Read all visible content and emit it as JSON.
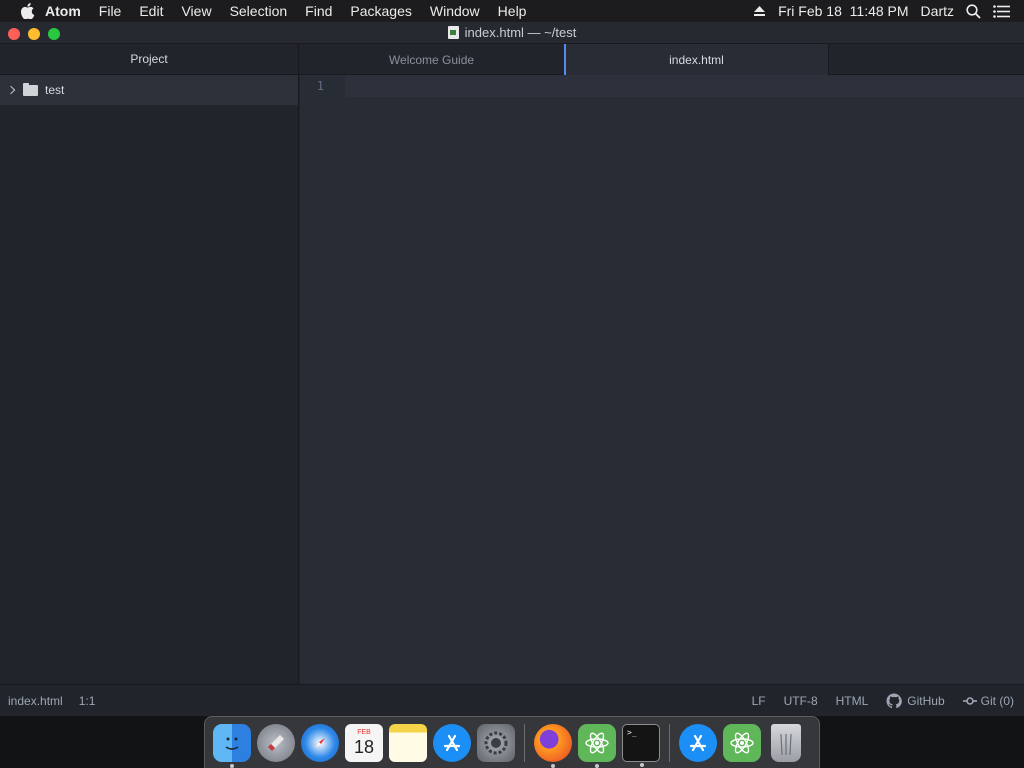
{
  "menubar": {
    "apple": "apple-icon",
    "app_name": "Atom",
    "items": [
      "File",
      "Edit",
      "View",
      "Selection",
      "Find",
      "Packages",
      "Window",
      "Help"
    ],
    "eject": "eject-icon",
    "datetime": "Fri Feb 18  11:48 PM",
    "user": "Dartz",
    "spotlight": "search-icon",
    "control_center": "list-icon"
  },
  "window": {
    "title": "index.html — ~/test",
    "title_icon": "html-file-icon"
  },
  "sidebar": {
    "header": "Project",
    "root": {
      "name": "test",
      "chevron": "chevron-right-icon",
      "icon": "folder-icon"
    }
  },
  "tabs": [
    {
      "label": "Welcome Guide",
      "active": false
    },
    {
      "label": "index.html",
      "active": true
    }
  ],
  "editor": {
    "line_numbers": [
      "1"
    ],
    "content": ""
  },
  "statusbar": {
    "file": "index.html",
    "cursor": "1:1",
    "line_ending": "LF",
    "encoding": "UTF-8",
    "grammar": "HTML",
    "github": "GitHub",
    "github_icon": "github-icon",
    "git": "Git (0)",
    "git_icon": "git-commit-icon"
  },
  "dock": {
    "calendar_month": "FEB",
    "calendar_day": "18",
    "terminal_prompt": ">_",
    "apps": [
      "finder",
      "launchpad",
      "safari",
      "calendar",
      "notes",
      "app-store",
      "system-preferences",
      "firefox",
      "atom",
      "terminal",
      "app-store",
      "atom",
      "trash"
    ]
  },
  "colors": {
    "accent": "#568af2",
    "editor_bg": "#282c34",
    "panel_bg": "#21252b"
  }
}
